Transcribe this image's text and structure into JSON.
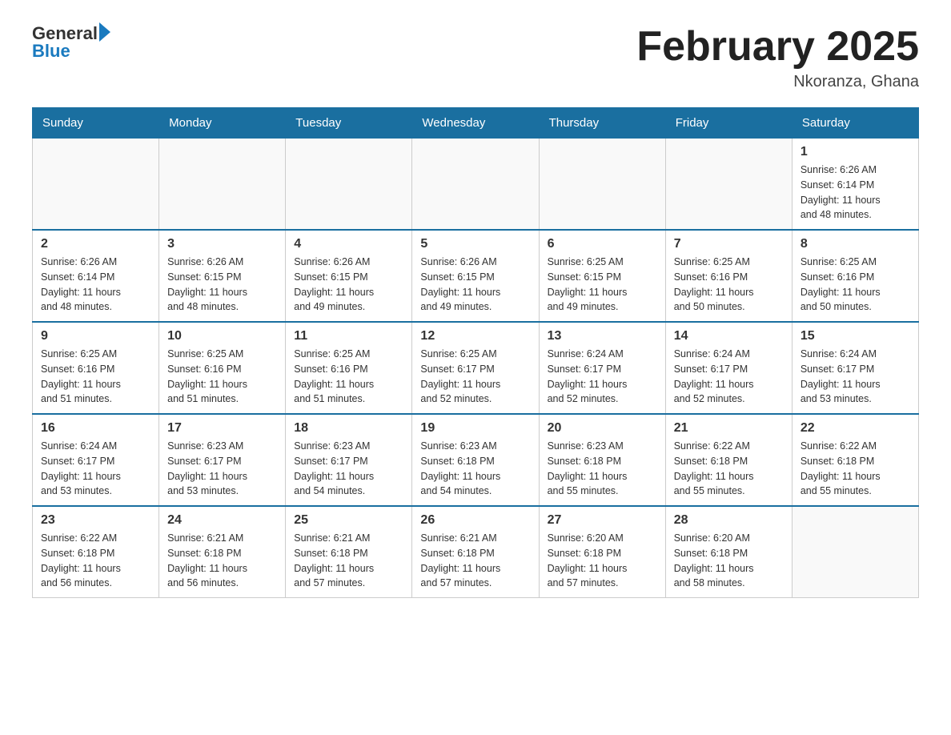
{
  "header": {
    "logo_text_general": "General",
    "logo_text_blue": "Blue",
    "title": "February 2025",
    "subtitle": "Nkoranza, Ghana"
  },
  "weekdays": [
    "Sunday",
    "Monday",
    "Tuesday",
    "Wednesday",
    "Thursday",
    "Friday",
    "Saturday"
  ],
  "weeks": [
    [
      {
        "day": "",
        "info": ""
      },
      {
        "day": "",
        "info": ""
      },
      {
        "day": "",
        "info": ""
      },
      {
        "day": "",
        "info": ""
      },
      {
        "day": "",
        "info": ""
      },
      {
        "day": "",
        "info": ""
      },
      {
        "day": "1",
        "info": "Sunrise: 6:26 AM\nSunset: 6:14 PM\nDaylight: 11 hours\nand 48 minutes."
      }
    ],
    [
      {
        "day": "2",
        "info": "Sunrise: 6:26 AM\nSunset: 6:14 PM\nDaylight: 11 hours\nand 48 minutes."
      },
      {
        "day": "3",
        "info": "Sunrise: 6:26 AM\nSunset: 6:15 PM\nDaylight: 11 hours\nand 48 minutes."
      },
      {
        "day": "4",
        "info": "Sunrise: 6:26 AM\nSunset: 6:15 PM\nDaylight: 11 hours\nand 49 minutes."
      },
      {
        "day": "5",
        "info": "Sunrise: 6:26 AM\nSunset: 6:15 PM\nDaylight: 11 hours\nand 49 minutes."
      },
      {
        "day": "6",
        "info": "Sunrise: 6:25 AM\nSunset: 6:15 PM\nDaylight: 11 hours\nand 49 minutes."
      },
      {
        "day": "7",
        "info": "Sunrise: 6:25 AM\nSunset: 6:16 PM\nDaylight: 11 hours\nand 50 minutes."
      },
      {
        "day": "8",
        "info": "Sunrise: 6:25 AM\nSunset: 6:16 PM\nDaylight: 11 hours\nand 50 minutes."
      }
    ],
    [
      {
        "day": "9",
        "info": "Sunrise: 6:25 AM\nSunset: 6:16 PM\nDaylight: 11 hours\nand 51 minutes."
      },
      {
        "day": "10",
        "info": "Sunrise: 6:25 AM\nSunset: 6:16 PM\nDaylight: 11 hours\nand 51 minutes."
      },
      {
        "day": "11",
        "info": "Sunrise: 6:25 AM\nSunset: 6:16 PM\nDaylight: 11 hours\nand 51 minutes."
      },
      {
        "day": "12",
        "info": "Sunrise: 6:25 AM\nSunset: 6:17 PM\nDaylight: 11 hours\nand 52 minutes."
      },
      {
        "day": "13",
        "info": "Sunrise: 6:24 AM\nSunset: 6:17 PM\nDaylight: 11 hours\nand 52 minutes."
      },
      {
        "day": "14",
        "info": "Sunrise: 6:24 AM\nSunset: 6:17 PM\nDaylight: 11 hours\nand 52 minutes."
      },
      {
        "day": "15",
        "info": "Sunrise: 6:24 AM\nSunset: 6:17 PM\nDaylight: 11 hours\nand 53 minutes."
      }
    ],
    [
      {
        "day": "16",
        "info": "Sunrise: 6:24 AM\nSunset: 6:17 PM\nDaylight: 11 hours\nand 53 minutes."
      },
      {
        "day": "17",
        "info": "Sunrise: 6:23 AM\nSunset: 6:17 PM\nDaylight: 11 hours\nand 53 minutes."
      },
      {
        "day": "18",
        "info": "Sunrise: 6:23 AM\nSunset: 6:17 PM\nDaylight: 11 hours\nand 54 minutes."
      },
      {
        "day": "19",
        "info": "Sunrise: 6:23 AM\nSunset: 6:18 PM\nDaylight: 11 hours\nand 54 minutes."
      },
      {
        "day": "20",
        "info": "Sunrise: 6:23 AM\nSunset: 6:18 PM\nDaylight: 11 hours\nand 55 minutes."
      },
      {
        "day": "21",
        "info": "Sunrise: 6:22 AM\nSunset: 6:18 PM\nDaylight: 11 hours\nand 55 minutes."
      },
      {
        "day": "22",
        "info": "Sunrise: 6:22 AM\nSunset: 6:18 PM\nDaylight: 11 hours\nand 55 minutes."
      }
    ],
    [
      {
        "day": "23",
        "info": "Sunrise: 6:22 AM\nSunset: 6:18 PM\nDaylight: 11 hours\nand 56 minutes."
      },
      {
        "day": "24",
        "info": "Sunrise: 6:21 AM\nSunset: 6:18 PM\nDaylight: 11 hours\nand 56 minutes."
      },
      {
        "day": "25",
        "info": "Sunrise: 6:21 AM\nSunset: 6:18 PM\nDaylight: 11 hours\nand 57 minutes."
      },
      {
        "day": "26",
        "info": "Sunrise: 6:21 AM\nSunset: 6:18 PM\nDaylight: 11 hours\nand 57 minutes."
      },
      {
        "day": "27",
        "info": "Sunrise: 6:20 AM\nSunset: 6:18 PM\nDaylight: 11 hours\nand 57 minutes."
      },
      {
        "day": "28",
        "info": "Sunrise: 6:20 AM\nSunset: 6:18 PM\nDaylight: 11 hours\nand 58 minutes."
      },
      {
        "day": "",
        "info": ""
      }
    ]
  ]
}
